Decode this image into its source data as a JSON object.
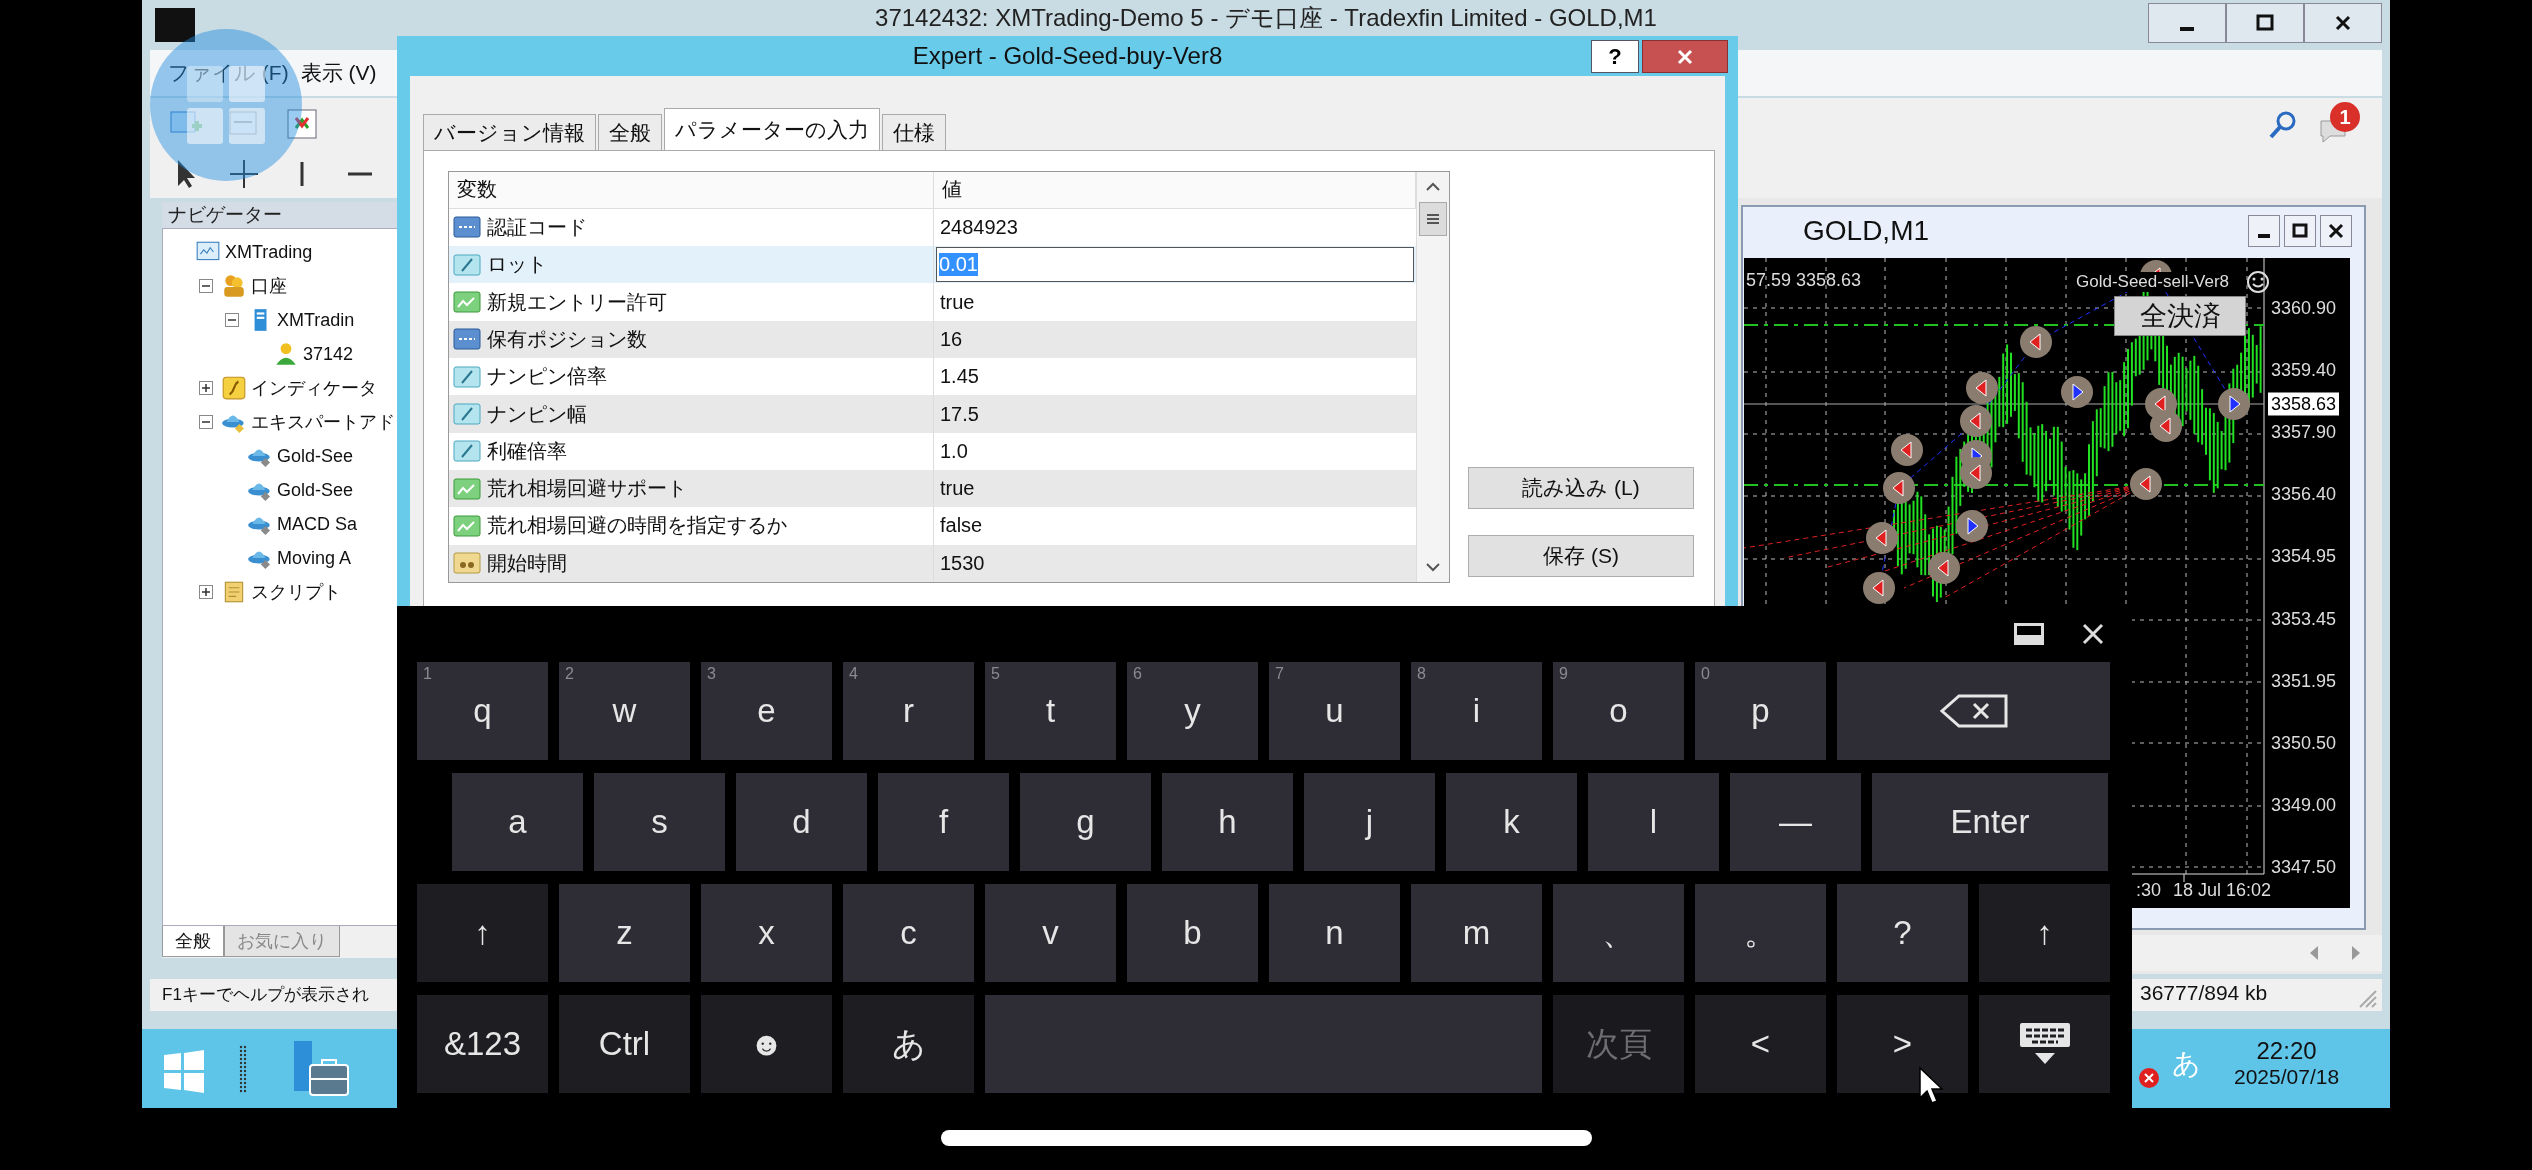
{
  "main_window": {
    "title": "37142432: XMTrading-Demo 5 - デモ口座 - Tradexfin Limited - GOLD,M1",
    "menu": [
      "ファイル (F)",
      "表示 (V)"
    ],
    "notification_badge": "1"
  },
  "navigator": {
    "title": "ナビゲーター",
    "tree": [
      {
        "label": "XMTrading",
        "kind": "terminal",
        "children": [
          {
            "label": "口座",
            "kind": "accounts",
            "expanded": true,
            "children": [
              {
                "label": "XMTradin",
                "kind": "server",
                "expanded": true,
                "children": [
                  {
                    "label": "37142",
                    "kind": "user"
                  }
                ]
              }
            ]
          },
          {
            "label": "インディケータ",
            "kind": "indicators",
            "expanded": false
          },
          {
            "label": "エキスパートアド",
            "kind": "experts",
            "expanded": true,
            "children": [
              {
                "label": "Gold-See",
                "kind": "expert"
              },
              {
                "label": "Gold-See",
                "kind": "expert"
              },
              {
                "label": "MACD Sa",
                "kind": "expert"
              },
              {
                "label": "Moving A",
                "kind": "expert"
              }
            ]
          },
          {
            "label": "スクリプト",
            "kind": "scripts",
            "expanded": false
          }
        ]
      }
    ],
    "tabs": [
      {
        "label": "全般",
        "selected": true
      },
      {
        "label": "お気に入り",
        "selected": false
      }
    ]
  },
  "dialog": {
    "title": "Expert - Gold-Seed-buy-Ver8",
    "help_button": "?",
    "tabs": [
      {
        "label": "バージョン情報",
        "selected": false
      },
      {
        "label": "全般",
        "selected": false
      },
      {
        "label": "パラメーターの入力",
        "selected": true
      },
      {
        "label": "仕様",
        "selected": false
      }
    ],
    "columns": [
      "変数",
      "値"
    ],
    "rows": [
      {
        "kind": "int",
        "name": "認証コード",
        "value": "2484923",
        "selected": false
      },
      {
        "kind": "double",
        "name": "ロット",
        "value": "0.01",
        "selected": true
      },
      {
        "kind": "bool",
        "name": "新規エントリー許可",
        "value": "true",
        "selected": false
      },
      {
        "kind": "int",
        "name": "保有ポジション数",
        "value": "16",
        "selected": false
      },
      {
        "kind": "double",
        "name": "ナンピン倍率",
        "value": "1.45",
        "selected": false
      },
      {
        "kind": "double",
        "name": "ナンピン幅",
        "value": "17.5",
        "selected": false
      },
      {
        "kind": "double",
        "name": "利確倍率",
        "value": "1.0",
        "selected": false
      },
      {
        "kind": "bool",
        "name": "荒れ相場回避サポート",
        "value": "true",
        "selected": false
      },
      {
        "kind": "bool",
        "name": "荒れ相場回避の時間を指定するか",
        "value": "false",
        "selected": false
      },
      {
        "kind": "string",
        "name": "開始時間",
        "value": "1530",
        "selected": false
      }
    ],
    "buttons": [
      "読み込み (L)",
      "保存 (S)"
    ]
  },
  "chart": {
    "title": "GOLD,M1",
    "quote": "57.59 3358.63",
    "expert_label": "Gold-Seed-sell-Ver8",
    "close_all_button": "全決済",
    "price_labels": [
      {
        "label": "3360.90",
        "kind": "tick"
      },
      {
        "label": "3359.40",
        "kind": "tick"
      },
      {
        "label": "3358.63",
        "kind": "bid"
      },
      {
        "label": "3357.90",
        "kind": "tick"
      },
      {
        "label": "3356.40",
        "kind": "tick"
      },
      {
        "label": "3354.95",
        "kind": "tick"
      },
      {
        "label": "3353.45",
        "kind": "tick"
      },
      {
        "label": "3351.95",
        "kind": "tick"
      },
      {
        "label": "3350.50",
        "kind": "tick"
      },
      {
        "label": "3349.00",
        "kind": "tick"
      },
      {
        "label": "3347.50",
        "kind": "tick"
      }
    ],
    "time_labels": [
      ":30",
      "18 Jul 16:02"
    ]
  },
  "status_bar": {
    "help_text": "F1キーでヘルプが表示され",
    "memory": "36777/894 kb"
  },
  "taskbar": {
    "ime": "あ",
    "time": "22:20",
    "date": "2025/07/18"
  },
  "keyboard": {
    "rows": [
      {
        "keys": [
          {
            "label": "q",
            "hint": "1",
            "kind": "letter",
            "disabled": false
          },
          {
            "label": "w",
            "hint": "2",
            "kind": "letter",
            "disabled": false
          },
          {
            "label": "e",
            "hint": "3",
            "kind": "letter",
            "disabled": false
          },
          {
            "label": "r",
            "hint": "4",
            "kind": "letter",
            "disabled": false
          },
          {
            "label": "t",
            "hint": "5",
            "kind": "letter",
            "disabled": false
          },
          {
            "label": "y",
            "hint": "6",
            "kind": "letter",
            "disabled": false
          },
          {
            "label": "u",
            "hint": "7",
            "kind": "letter",
            "disabled": false
          },
          {
            "label": "i",
            "hint": "8",
            "kind": "letter",
            "disabled": false
          },
          {
            "label": "o",
            "hint": "9",
            "kind": "letter",
            "disabled": false
          },
          {
            "label": "p",
            "hint": "0",
            "kind": "letter",
            "disabled": false
          },
          {
            "kind": "backspace",
            "disabled": false
          }
        ]
      },
      {
        "keys": [
          {
            "label": "a",
            "kind": "letter",
            "disabled": false
          },
          {
            "label": "s",
            "kind": "letter",
            "disabled": false
          },
          {
            "label": "d",
            "kind": "letter",
            "disabled": false
          },
          {
            "label": "f",
            "kind": "letter",
            "disabled": false
          },
          {
            "label": "g",
            "kind": "letter",
            "disabled": false
          },
          {
            "label": "h",
            "kind": "letter",
            "disabled": false
          },
          {
            "label": "j",
            "kind": "letter",
            "disabled": false
          },
          {
            "label": "k",
            "kind": "letter",
            "disabled": false
          },
          {
            "label": "l",
            "kind": "letter",
            "disabled": false
          },
          {
            "label": "—",
            "kind": "letter",
            "disabled": false
          },
          {
            "label": "Enter",
            "kind": "enter",
            "disabled": false
          }
        ]
      },
      {
        "keys": [
          {
            "label": "↑",
            "kind": "shift",
            "disabled": false
          },
          {
            "label": "z",
            "kind": "letter",
            "disabled": false
          },
          {
            "label": "x",
            "kind": "letter",
            "disabled": false
          },
          {
            "label": "c",
            "kind": "letter",
            "disabled": false
          },
          {
            "label": "v",
            "kind": "letter",
            "disabled": false
          },
          {
            "label": "b",
            "kind": "letter",
            "disabled": false
          },
          {
            "label": "n",
            "kind": "letter",
            "disabled": false
          },
          {
            "label": "m",
            "kind": "letter",
            "disabled": false
          },
          {
            "label": "、",
            "kind": "letter",
            "disabled": false
          },
          {
            "label": "。",
            "kind": "letter",
            "disabled": false
          },
          {
            "label": "?",
            "kind": "letter",
            "disabled": false
          },
          {
            "label": "↑",
            "kind": "shift",
            "disabled": false
          }
        ]
      },
      {
        "keys": [
          {
            "label": "&123",
            "kind": "function",
            "disabled": false
          },
          {
            "label": "Ctrl",
            "kind": "function",
            "disabled": false
          },
          {
            "label": "☻",
            "kind": "function",
            "disabled": false
          },
          {
            "label": "あ",
            "kind": "function",
            "disabled": false
          },
          {
            "kind": "space",
            "disabled": false
          },
          {
            "label": "次頁",
            "kind": "function",
            "disabled": true
          },
          {
            "label": "<",
            "kind": "function",
            "disabled": false
          },
          {
            "label": ">",
            "kind": "function",
            "disabled": false
          },
          {
            "kind": "hide",
            "disabled": false
          }
        ]
      }
    ]
  }
}
